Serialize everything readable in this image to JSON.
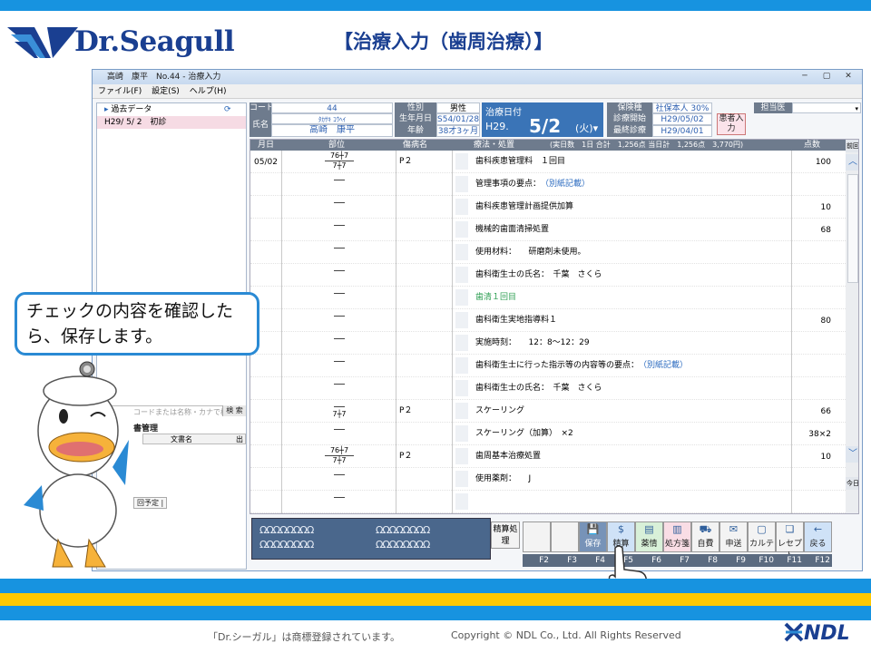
{
  "slide": {
    "logo_text": "Dr.Seagull",
    "title": "【治療入力（歯周治療）】",
    "callout": "チェックの内容を確認したら、保存します。",
    "footer_trademark": "「Dr.シーガル」は商標登録されています。",
    "footer_copyright": "Copyright © NDL Co., Ltd. All Rights Reserved",
    "ndl_logo": "NDL"
  },
  "window": {
    "title": "高崎　康平　No.44 - 治療入力",
    "menu": [
      "ファイル(F)",
      "設定(S)",
      "ヘルプ(H)"
    ]
  },
  "left_pane": {
    "tree_root": "過去データ",
    "visit_entry": "H29/ 5/ 2　初診",
    "search_placeholder": "コードまたは名称・カナで検索",
    "search_button": "検 索",
    "doc_section": "書管理",
    "doc_col": "文書名",
    "doc_col2": "出",
    "tab_next": "回予定 |"
  },
  "patient": {
    "code_label": "コード",
    "code": "44",
    "name_label": "氏名",
    "kana": "ﾀｶｻｷ ｺｳﾍｲ",
    "name": "高崎　康平",
    "sex_label": "性別",
    "sex": "男性",
    "dob_label": "生年月日",
    "dob": "S54/01/28",
    "age_label": "年齢",
    "age": "38才3ヶ月",
    "date_label": "治療日付",
    "era": "H29.",
    "month_day": "5/2",
    "dow": "(火)▾",
    "ins_label": "保険種",
    "ins": "社保本人 30%",
    "start_label": "診療開始",
    "start": "H29/05/02",
    "last_label": "最終診療",
    "last": "H29/04/01",
    "doctor_label": "担当医",
    "kanja_button": "患者入力"
  },
  "grid": {
    "headers": {
      "date": "月日",
      "part": "部位",
      "disease": "傷病名",
      "treatment": "療法・処置",
      "summary": "(実日数　1日 合計　1,256点 当日計　1,256点　3,770円)",
      "points": "点数"
    },
    "rows": [
      {
        "date": "05/02",
        "pos1": "76┼7",
        "pos2": "7┼7",
        "sick": "P２",
        "tx": "歯科疾患管理料　１回目",
        "pt": "100",
        "cls": ""
      },
      {
        "date": "",
        "pos1": "",
        "pos2": "",
        "sick": "",
        "tx": "管理事項の要点：　（別紙記載）",
        "pt": "",
        "cls": "blue"
      },
      {
        "date": "",
        "pos1": "",
        "pos2": "",
        "sick": "",
        "tx": "歯科疾患管理計画提供加算",
        "pt": "10",
        "cls": ""
      },
      {
        "date": "",
        "pos1": "",
        "pos2": "",
        "sick": "",
        "tx": "機械的歯面清掃処置",
        "pt": "68",
        "cls": ""
      },
      {
        "date": "",
        "pos1": "",
        "pos2": "",
        "sick": "",
        "tx": "使用材料：　　研磨剤未使用。",
        "pt": "",
        "cls": ""
      },
      {
        "date": "",
        "pos1": "",
        "pos2": "",
        "sick": "",
        "tx": "歯科衛生士の氏名：　千葉　さくら",
        "pt": "",
        "cls": ""
      },
      {
        "date": "",
        "pos1": "",
        "pos2": "",
        "sick": "",
        "tx": "歯清１回目",
        "pt": "",
        "cls": "green"
      },
      {
        "date": "",
        "pos1": "",
        "pos2": "",
        "sick": "",
        "tx": "歯科衛生実地指導料１",
        "pt": "80",
        "cls": ""
      },
      {
        "date": "",
        "pos1": "",
        "pos2": "",
        "sick": "",
        "tx": "実施時刻：　　12：8〜12：29",
        "pt": "",
        "cls": ""
      },
      {
        "date": "",
        "pos1": "",
        "pos2": "",
        "sick": "",
        "tx": "歯科衛生士に行った指示等の内容等の要点：　（別紙記載）",
        "pt": "",
        "cls": "blue2"
      },
      {
        "date": "",
        "pos1": "",
        "pos2": "",
        "sick": "",
        "tx": "歯科衛生士の氏名：　千葉　さくら",
        "pt": "",
        "cls": ""
      },
      {
        "date": "",
        "pos1": "",
        "pos2": "7┼7",
        "sick": "P２",
        "tx": "スケーリング",
        "pt": "66",
        "cls": ""
      },
      {
        "date": "",
        "pos1": "",
        "pos2": "",
        "sick": "",
        "tx": "スケーリング（加算）　×2",
        "pt": "38×2",
        "cls": ""
      },
      {
        "date": "",
        "pos1": "76┼7",
        "pos2": "7┼7",
        "sick": "P２",
        "tx": "歯周基本治療処置",
        "pt": "10",
        "cls": ""
      },
      {
        "date": "",
        "pos1": "",
        "pos2": "",
        "sick": "",
        "tx": "使用薬剤：　　J",
        "pt": "",
        "cls": ""
      },
      {
        "date": "",
        "pos1": "",
        "pos2": "",
        "sick": "",
        "tx": "",
        "pt": "",
        "cls": ""
      }
    ],
    "scroll_top": "前回",
    "scroll_bottom": "今日"
  },
  "teeth": {
    "upper_right": "ΩΩΩΩΩΩΩΩ",
    "upper_left": "ΩΩΩΩΩΩΩΩ"
  },
  "fkeys": {
    "seisan": "精算処理",
    "buttons": [
      {
        "label": "",
        "icon": "",
        "key": "F2",
        "cls": ""
      },
      {
        "label": "",
        "icon": "",
        "key": "F3",
        "cls": ""
      },
      {
        "label": "保存",
        "icon": "💾",
        "key": "F4",
        "cls": "save"
      },
      {
        "label": "精算",
        "icon": "$",
        "key": "F5",
        "cls": "blue"
      },
      {
        "label": "薬情",
        "icon": "▤",
        "key": "F6",
        "cls": "grn"
      },
      {
        "label": "処方箋",
        "icon": "▥",
        "key": "F7",
        "cls": "pink"
      },
      {
        "label": "自費",
        "icon": "⛟",
        "key": "F8",
        "cls": ""
      },
      {
        "label": "申送",
        "icon": "✉",
        "key": "F9",
        "cls": ""
      },
      {
        "label": "カルテ",
        "icon": "▢",
        "key": "F10",
        "cls": ""
      },
      {
        "label": "レセプト",
        "icon": "❏",
        "key": "F11",
        "cls": ""
      },
      {
        "label": "戻る",
        "icon": "←",
        "key": "F12",
        "cls": "blue"
      }
    ]
  },
  "colors": {
    "brand_blue": "#1793e0",
    "brand_yellow": "#ffc800",
    "navy": "#1a3f91"
  }
}
